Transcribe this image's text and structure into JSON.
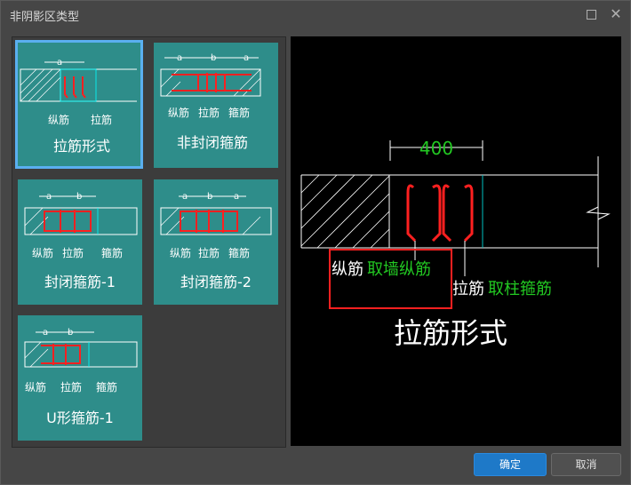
{
  "dialog": {
    "title": "非阴影区类型"
  },
  "tiles": [
    {
      "title": "拉筋形式",
      "labels": [
        "纵筋",
        "拉筋"
      ],
      "dim": "a"
    },
    {
      "title": "非封闭箍筋",
      "labels": [
        "纵筋",
        "拉筋",
        "箍筋"
      ],
      "dim1": "a",
      "dim2": "b",
      "dim3": "a"
    },
    {
      "title": "封闭箍筋-1",
      "labels": [
        "纵筋",
        "拉筋",
        "箍筋"
      ],
      "dim1": "a",
      "dim2": "b"
    },
    {
      "title": "封闭箍筋-2",
      "labels": [
        "纵筋",
        "拉筋",
        "箍筋"
      ],
      "dim1": "a",
      "dim2": "b",
      "dim3": "a"
    },
    {
      "title": "U形箍筋-1",
      "labels": [
        "纵筋",
        "拉筋",
        "箍筋"
      ],
      "dim1": "a",
      "dim2": "b"
    }
  ],
  "preview": {
    "dimension": "400",
    "label_vertical": "纵筋",
    "label_vertical_value": "取墙纵筋",
    "label_tie": "拉筋",
    "label_tie_value": "取柱箍筋",
    "title": "拉筋形式",
    "colors": {
      "value_green": "#22c822",
      "rebar_red": "#ff2020",
      "highlight_box": "#ff2020",
      "line_cyan": "#00c0c0"
    }
  },
  "buttons": {
    "ok": "确定",
    "cancel": "取消"
  },
  "colors": {
    "tile_bg": "#2e8d8a",
    "selected_border": "#5aaff0",
    "ok_blue": "#1e79c8"
  }
}
